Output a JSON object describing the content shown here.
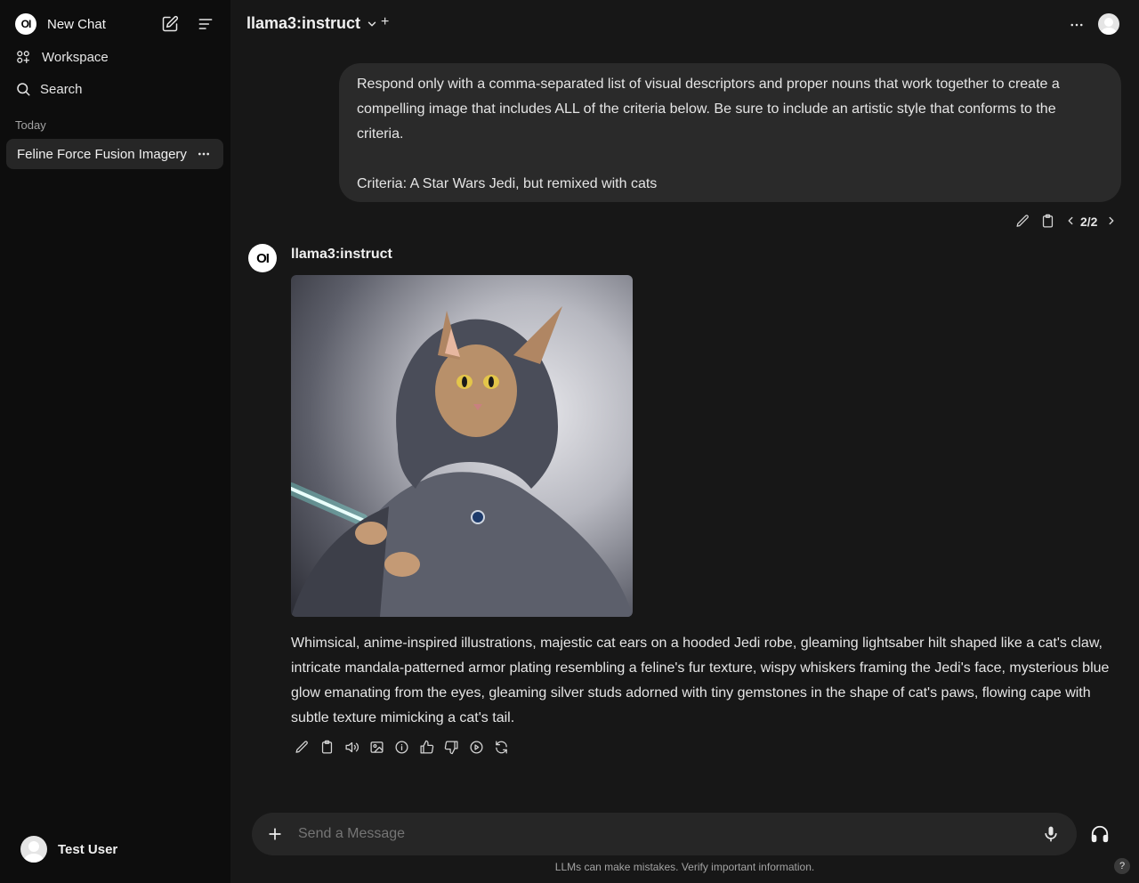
{
  "sidebar": {
    "logo_text": "OI",
    "new_chat_label": "New Chat",
    "workspace_label": "Workspace",
    "search_label": "Search",
    "section_today": "Today",
    "chats": [
      {
        "title": "Feline Force Fusion Imagery"
      }
    ],
    "user_name": "Test User"
  },
  "header": {
    "model_name": "llama3:instruct",
    "plus_label": "+"
  },
  "messages": {
    "user": {
      "text_p1": "Respond only with a comma-separated list of visual descriptors and proper nouns that work together to create a compelling image that includes ALL of the criteria below. Be sure to include an artistic style that conforms to the criteria.",
      "text_p2": "Criteria: A Star Wars Jedi, but remixed with cats",
      "pager": "2/2"
    },
    "assistant": {
      "model_name": "llama3:instruct",
      "text": "Whimsical, anime-inspired illustrations, majestic cat ears on a hooded Jedi robe, gleaming lightsaber hilt shaped like a cat's claw, intricate mandala-patterned armor plating resembling a feline's fur texture, wispy whiskers framing the Jedi's face, mysterious blue glow emanating from the eyes, gleaming silver studs adorned with tiny gemstones in the shape of cat's paws, flowing cape with subtle texture mimicking a cat's tail."
    }
  },
  "input": {
    "placeholder": "Send a Message"
  },
  "footer": {
    "disclaimer": "LLMs can make mistakes. Verify important information.",
    "help_label": "?"
  }
}
